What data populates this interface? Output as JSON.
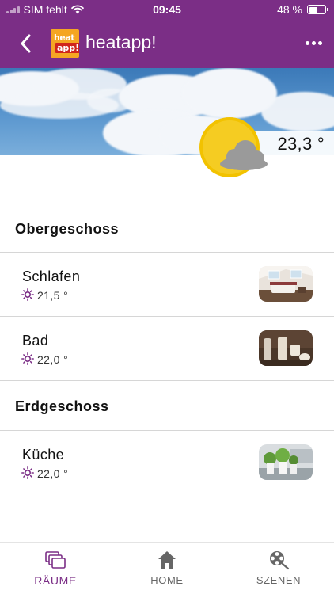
{
  "status_bar": {
    "carrier": "SIM fehlt",
    "time": "09:45",
    "battery": "48 %"
  },
  "header": {
    "back_icon": "chevron-left-icon",
    "logo_top": "heat",
    "logo_bottom": "app!",
    "title": "heatapp!",
    "more_icon": "more-horizontal-icon"
  },
  "weather": {
    "temperature": "23,3 °",
    "condition_icon": "partly-cloudy-icon"
  },
  "sections": [
    {
      "title": "Obergeschoss",
      "rooms": [
        {
          "name": "Schlafen",
          "temperature": "21,5 °",
          "icon": "sun-icon"
        },
        {
          "name": "Bad",
          "temperature": "22,0 °",
          "icon": "sun-icon"
        }
      ]
    },
    {
      "title": "Erdgeschoss",
      "rooms": [
        {
          "name": "Küche",
          "temperature": "22,0 °",
          "icon": "sun-icon"
        }
      ]
    }
  ],
  "tabbar": {
    "tabs": [
      {
        "label": "RÄUME",
        "icon": "rooms-icon",
        "active": true
      },
      {
        "label": "HOME",
        "icon": "home-icon",
        "active": false
      },
      {
        "label": "SZENEN",
        "icon": "scenes-icon",
        "active": false
      }
    ]
  },
  "colors": {
    "primary": "#7b2e86",
    "logo_orange": "#f5a623",
    "logo_red": "#d0251c",
    "sun_yellow": "#f2c200",
    "divider": "#d6d6d6"
  }
}
